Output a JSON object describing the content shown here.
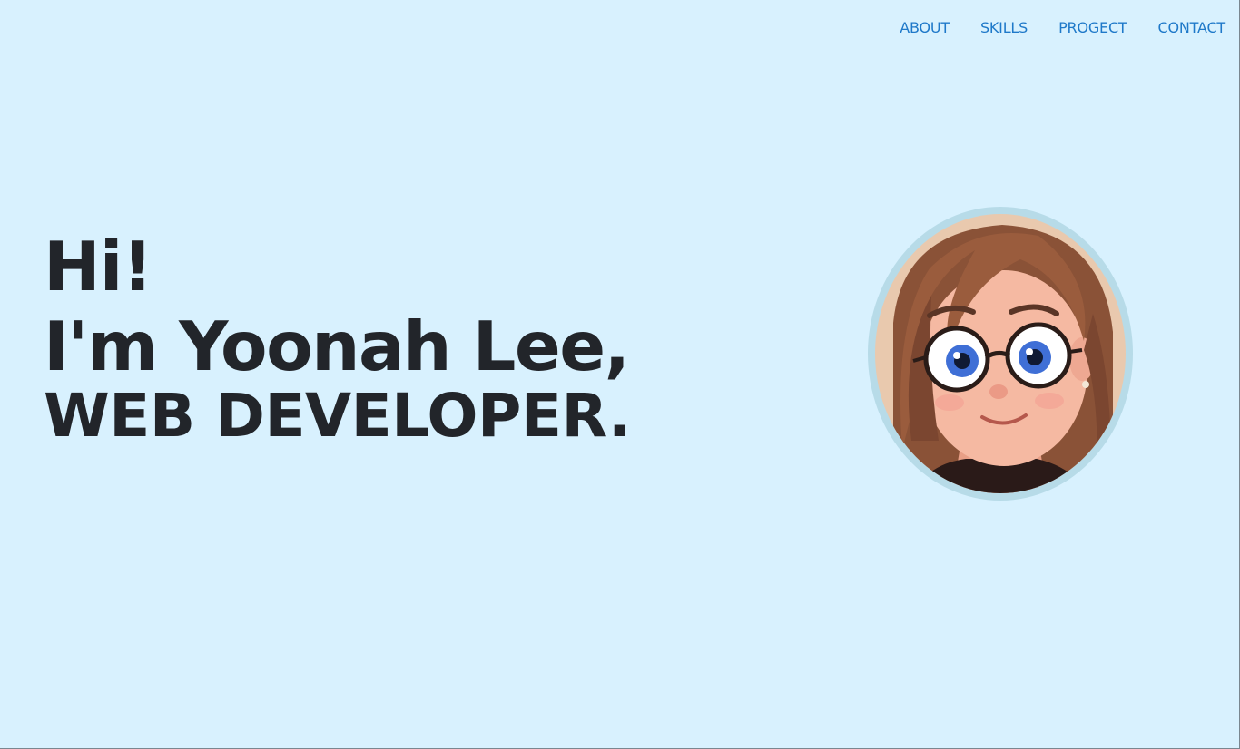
{
  "nav": {
    "items": [
      {
        "label": "ABOUT"
      },
      {
        "label": "SKILLS"
      },
      {
        "label": "PROGECT"
      },
      {
        "label": "CONTACT"
      }
    ]
  },
  "hero": {
    "line1": "Hi!",
    "line2": "I'm Yoonah Lee,",
    "line3": "WEB DEVELOPER."
  },
  "avatar": {
    "icon": "avatar-illustration"
  },
  "colors": {
    "background": "#d8f1fe",
    "nav_link": "#1f79c9",
    "heading": "#22252a",
    "avatar_ring": "#b7dbe8"
  }
}
